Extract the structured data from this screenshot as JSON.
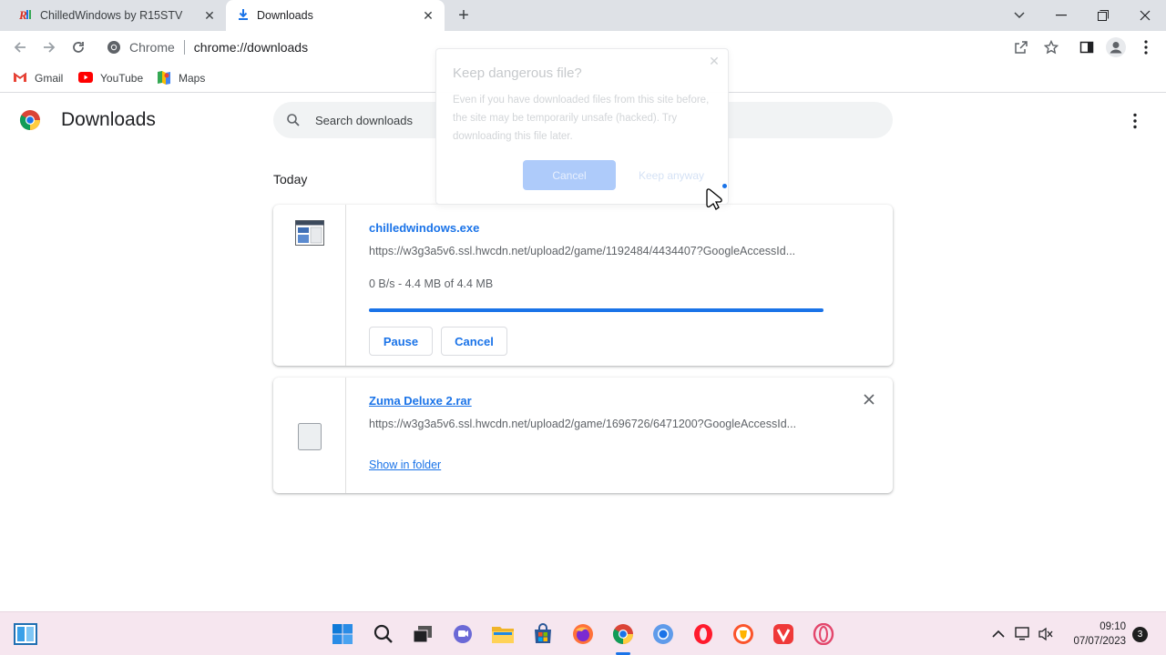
{
  "tabs": [
    {
      "title": "ChilledWindows by R15STV"
    },
    {
      "title": "Downloads"
    }
  ],
  "omnibox": {
    "site": "Chrome",
    "url": "chrome://downloads"
  },
  "bookmarks": [
    {
      "label": "Gmail"
    },
    {
      "label": "YouTube"
    },
    {
      "label": "Maps"
    }
  ],
  "page": {
    "title": "Downloads",
    "search_placeholder": "Search downloads",
    "section": "Today"
  },
  "downloads": [
    {
      "filename": "chilledwindows.exe",
      "url": "https://w3g3a5v6.ssl.hwcdn.net/upload2/game/1192484/4434407?GoogleAccessId...",
      "status": "0 B/s - 4.4 MB of 4.4 MB",
      "progress": 1.0,
      "pause_label": "Pause",
      "cancel_label": "Cancel"
    },
    {
      "filename": "Zuma Deluxe 2.rar",
      "url": "https://w3g3a5v6.ssl.hwcdn.net/upload2/game/1696726/6471200?GoogleAccessId...",
      "show_label": "Show in folder"
    }
  ],
  "dialog": {
    "title": "Keep dangerous file?",
    "body": "Even if you have downloaded files from this site before, the site may be temporarily unsafe (hacked). Try downloading this file later.",
    "cancel_label": "Cancel",
    "keep_label": "Keep anyway"
  },
  "taskbar": {
    "time": "09:10",
    "date": "07/07/2023",
    "notifications": "3"
  },
  "colors": {
    "accent": "#1a73e8",
    "tabstrip": "#dee1e6",
    "taskbar": "#f6e6ef"
  }
}
